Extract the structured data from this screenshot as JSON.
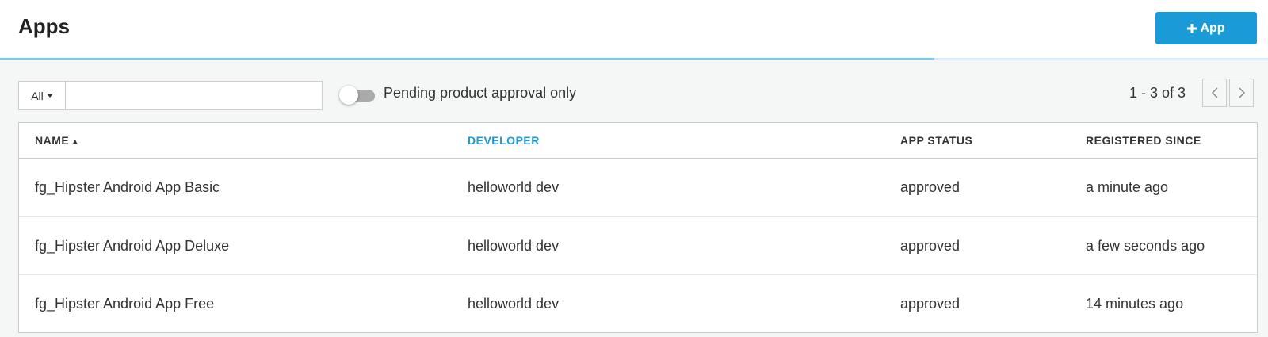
{
  "header": {
    "title": "Apps",
    "add_button_label": "App",
    "add_button_icon": "plus-icon"
  },
  "progress": {
    "fraction": 0.737
  },
  "filters": {
    "select_value": "All",
    "search_value": "",
    "search_placeholder": "",
    "toggle_label": "Pending product approval only",
    "toggle_on": false
  },
  "pagination": {
    "info": "1 - 3 of 3",
    "prev_icon": "chevron-left-icon",
    "next_icon": "chevron-right-icon"
  },
  "table": {
    "columns": [
      "NAME",
      "DEVELOPER",
      "APP STATUS",
      "REGISTERED SINCE"
    ],
    "sort_indicator": "▲",
    "rows": [
      [
        "fg_Hipster Android App Basic",
        "helloworld dev",
        "approved",
        "a minute ago"
      ],
      [
        "fg_Hipster Android App Deluxe",
        "helloworld dev",
        "approved",
        "a few seconds ago"
      ],
      [
        "fg_Hipster Android App Free",
        "helloworld dev",
        "approved",
        "14 minutes ago"
      ]
    ]
  },
  "colors": {
    "accent": "#1a9bd7",
    "progress_fill": "#7ccaf2",
    "progress_track": "#d9ecf8",
    "background": "#f5f6f6"
  }
}
